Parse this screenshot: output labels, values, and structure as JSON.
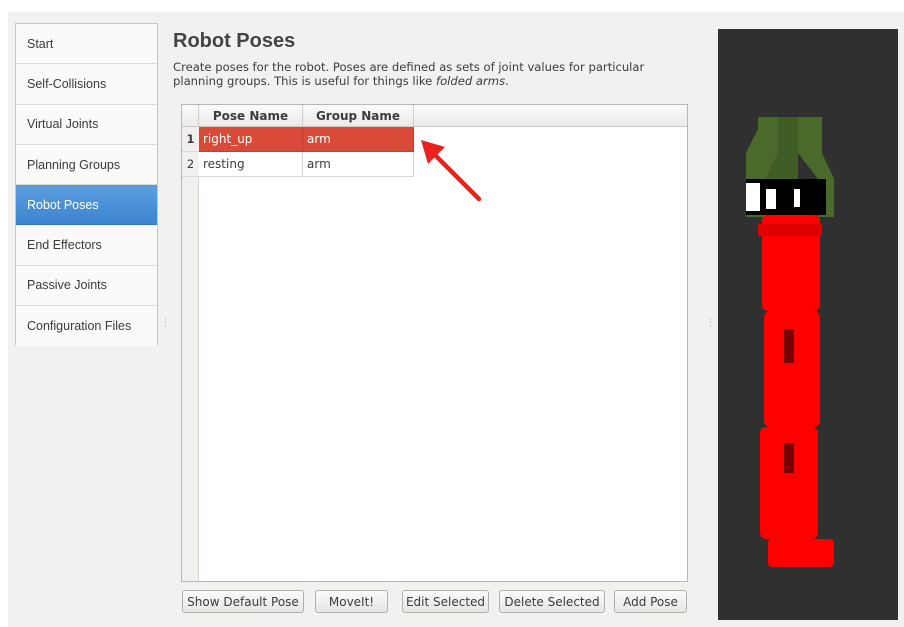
{
  "sidebar": {
    "items": [
      {
        "label": "Start",
        "active": false
      },
      {
        "label": "Self-Collisions",
        "active": false
      },
      {
        "label": "Virtual Joints",
        "active": false
      },
      {
        "label": "Planning Groups",
        "active": false
      },
      {
        "label": "Robot Poses",
        "active": true
      },
      {
        "label": "End Effectors",
        "active": false
      },
      {
        "label": "Passive Joints",
        "active": false
      },
      {
        "label": "Configuration Files",
        "active": false
      }
    ]
  },
  "main": {
    "title": "Robot Poses",
    "description_main": "Create poses for the robot. Poses are defined as sets of joint values for particular planning groups. This is useful for things like ",
    "description_italic": "folded arms",
    "description_end": "."
  },
  "table": {
    "columns": [
      "Pose Name",
      "Group Name"
    ],
    "rows": [
      {
        "num": "1",
        "pose_name": "right_up",
        "group_name": "arm",
        "selected": true
      },
      {
        "num": "2",
        "pose_name": "resting",
        "group_name": "arm",
        "selected": false
      }
    ]
  },
  "buttons": {
    "show_default": "Show Default Pose",
    "moveit": "MoveIt!",
    "edit_selected": "Edit Selected",
    "delete_selected": "Delete Selected",
    "add_pose": "Add Pose"
  },
  "colors": {
    "selection": "#da4a38",
    "active_nav": "#3c84cf",
    "annotation_arrow": "#e8231d",
    "robot_body": "#ff0000",
    "gripper": "#4a6a2c",
    "viewer_bg": "#303030"
  },
  "icons": {
    "annotation": "red-arrow-icon",
    "splitter": "splitter-grip-icon"
  }
}
